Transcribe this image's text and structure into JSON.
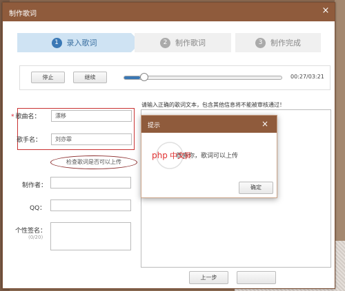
{
  "window": {
    "title": "制作歌词"
  },
  "steps": [
    {
      "number": "1",
      "label": "录入歌词",
      "active": true
    },
    {
      "number": "2",
      "label": "制作歌词",
      "active": false
    },
    {
      "number": "3",
      "label": "制作完成",
      "active": false
    }
  ],
  "player": {
    "stop_label": "停止",
    "continue_label": "继续",
    "progress": 0.1,
    "time": "00:27/03:21"
  },
  "form": {
    "song_name_label": "歌曲名：",
    "song_name_value": "漂移",
    "singer_label": "歌手名：",
    "singer_value": "刘亦霏",
    "check_link": "检查歌词是否可以上传",
    "producer_label": "制作者：",
    "producer_value": "",
    "qq_label": "QQ：",
    "qq_value": "",
    "signature_label": "个性签名：",
    "signature_count": "(0/20)"
  },
  "lyrics": {
    "notice": "请输入正确的歌词文本，包含其他信息将不能被审核通过！"
  },
  "footer": {
    "prev_label": "上一步"
  },
  "modal": {
    "title": "提示",
    "message": "恭喜你，歌词可以上传",
    "ok_label": "确定"
  },
  "watermark": {
    "text": "php中文网"
  },
  "colors": {
    "title_bar": "#8f5b3c",
    "accent": "#3a78b5",
    "required_outline": "#c83030"
  }
}
